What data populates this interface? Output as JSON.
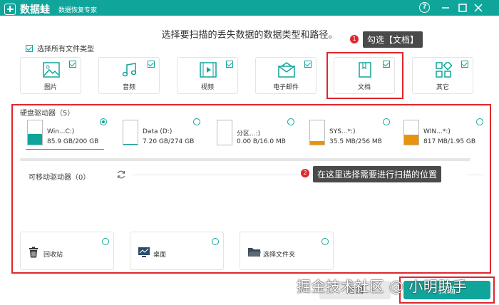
{
  "titlebar": {
    "app_name": "数据蛙",
    "subtitle": "数据恢复专家"
  },
  "prompt": "选择要扫描的丢失数据的数据类型和路径。",
  "select_all": {
    "label": "选择所有文件类型",
    "checked": true
  },
  "file_types": [
    {
      "label": "图片",
      "checked": true,
      "icon": "image-icon"
    },
    {
      "label": "音频",
      "checked": true,
      "icon": "music-icon"
    },
    {
      "label": "视频",
      "checked": true,
      "icon": "video-icon"
    },
    {
      "label": "电子邮件",
      "checked": true,
      "icon": "email-icon"
    },
    {
      "label": "文档",
      "checked": true,
      "icon": "document-icon"
    },
    {
      "label": "其它",
      "checked": true,
      "icon": "other-icon"
    }
  ],
  "annotations": {
    "one": {
      "num": "1",
      "text": "勾选【文档】"
    },
    "two": {
      "num": "2",
      "text": "在这里选择需要进行扫描的位置"
    }
  },
  "hard_drives": {
    "title": "硬盘驱动器（5）",
    "drives": [
      {
        "name": "Win...C:)",
        "size": "85.9 GB/200 GB",
        "selected": true,
        "fill_fraction": 0.43,
        "fill_color": "#10a59b"
      },
      {
        "name": "Data (D:)",
        "size": "7.20 GB/274 GB",
        "selected": false,
        "fill_fraction": 0.03,
        "fill_color": "#10a59b"
      },
      {
        "name": "分区...:)",
        "size": "0.00  B/16.0 MB",
        "selected": false,
        "fill_fraction": 0.0,
        "fill_color": "#e8930c"
      },
      {
        "name": "SYS...*:)",
        "size": "35.5 MB/256 MB",
        "selected": false,
        "fill_fraction": 0.14,
        "fill_color": "#e8930c"
      },
      {
        "name": "WIN...*:)",
        "size": "817 MB/1.95 GB",
        "selected": false,
        "fill_fraction": 0.42,
        "fill_color": "#e8930c"
      }
    ]
  },
  "removable": {
    "title": "可移动驱动器（0）"
  },
  "locations": [
    {
      "label": "回收站",
      "icon": "recycle-bin-icon"
    },
    {
      "label": "桌面",
      "icon": "desktop-icon"
    },
    {
      "label": "选择文件夹",
      "icon": "folder-icon"
    }
  ],
  "buttons": {
    "back": "返回",
    "scan": "扫描"
  },
  "watermark": "掘金技术社区 @ 小明助手",
  "colors": {
    "accent": "#10a59b",
    "highlight": "#e0262d",
    "callout": "#4a4a4a",
    "drive_warn": "#e8930c"
  }
}
